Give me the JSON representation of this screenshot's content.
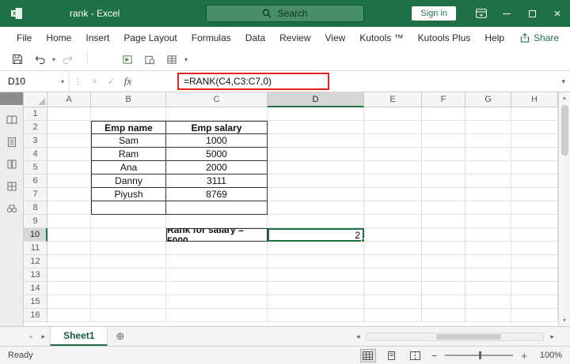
{
  "titlebar": {
    "title": "rank - Excel",
    "search_placeholder": "Search",
    "sign_in_label": "Sign in"
  },
  "menu": {
    "tabs": [
      "File",
      "Home",
      "Insert",
      "Page Layout",
      "Formulas",
      "Data",
      "Review",
      "View",
      "Kutools ™",
      "Kutools Plus",
      "Help"
    ],
    "share_label": "Share"
  },
  "formula_bar": {
    "name_box": "D10",
    "formula": "=RANK(C4,C3:C7,0)"
  },
  "grid": {
    "columns": [
      "A",
      "B",
      "C",
      "D",
      "E",
      "F",
      "G",
      "H"
    ],
    "rows": [
      "1",
      "2",
      "3",
      "4",
      "5",
      "6",
      "7",
      "8",
      "9",
      "10",
      "11",
      "12",
      "13",
      "14",
      "15",
      "16"
    ],
    "selected_cell": "D10"
  },
  "table": {
    "headers": [
      "Emp name",
      "Emp salary"
    ],
    "rows": [
      [
        "Sam",
        "1000"
      ],
      [
        "Ram",
        "5000"
      ],
      [
        "Ana",
        "2000"
      ],
      [
        "Danny",
        "3111"
      ],
      [
        "Piyush",
        "8769"
      ]
    ]
  },
  "result": {
    "label": "Rank for salary = 5000",
    "value": "2"
  },
  "sheet_bar": {
    "active_tab": "Sheet1"
  },
  "status_bar": {
    "mode": "Ready",
    "zoom": "100%"
  },
  "colors": {
    "excel_green": "#217346",
    "titlebar_green": "#1e7145",
    "annotation_red": "#e1251b"
  }
}
